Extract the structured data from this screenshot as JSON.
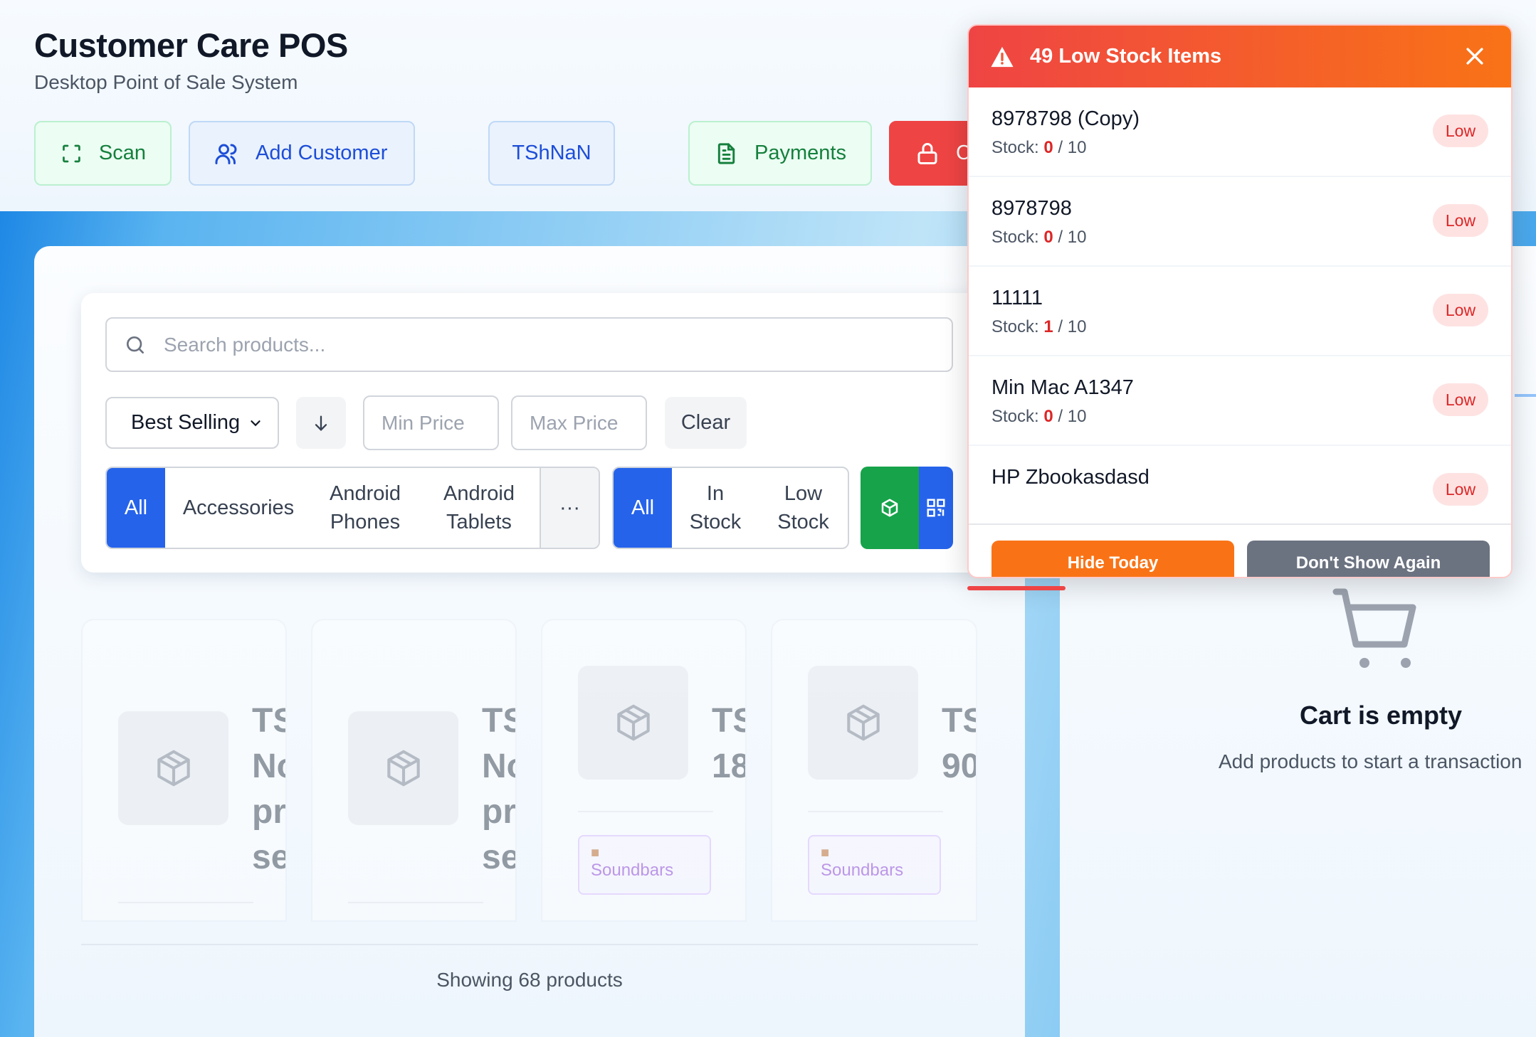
{
  "header": {
    "title": "Customer Care POS",
    "subtitle": "Desktop Point of Sale System",
    "buttons": {
      "scan": "Scan",
      "add_customer": "Add Customer",
      "currency": "TShNaN",
      "payments": "Payments",
      "close_partial": "C"
    }
  },
  "filters": {
    "search_placeholder": "Search products...",
    "sort_value": "Best Selling",
    "min_price_placeholder": "Min Price",
    "max_price_placeholder": "Max Price",
    "clear_label": "Clear",
    "categories": [
      "All",
      "Accessories",
      "Android Phones",
      "Android Tablets"
    ],
    "more_label": "···",
    "stock_filters": [
      "All",
      "In Stock",
      "Low Stock"
    ]
  },
  "products": [
    {
      "name_lines": [
        "TS",
        "No",
        "pr",
        "se"
      ],
      "category": ""
    },
    {
      "name_lines": [
        "TS",
        "No",
        "pr",
        "se"
      ],
      "category": ""
    },
    {
      "name_lines": [
        "TS",
        "18"
      ],
      "category": "Soundbars"
    },
    {
      "name_lines": [
        "TS",
        "90"
      ],
      "category": "Soundbars"
    }
  ],
  "footer": {
    "showing": "Showing 68 products"
  },
  "cart": {
    "title": "Cart is empty",
    "subtitle": "Add products to start a transaction"
  },
  "low_stock_popup": {
    "title": "49 Low Stock Items",
    "stock_label": "Stock:",
    "badge": "Low",
    "items": [
      {
        "name": "8978798 (Copy)",
        "stock": "0",
        "max": "/ 10"
      },
      {
        "name": "8978798",
        "stock": "0",
        "max": "/ 10"
      },
      {
        "name": "11111",
        "stock": "1",
        "max": "/ 10"
      },
      {
        "name": "Min Mac A1347",
        "stock": "0",
        "max": "/ 10"
      },
      {
        "name": "HP Zbookasdasd",
        "stock": "",
        "max": ""
      }
    ],
    "hide_today": "Hide Today",
    "dont_show": "Don't Show Again",
    "timer_progress": 0.18
  },
  "colors": {
    "primary": "#2563eb",
    "success": "#16a34a",
    "danger": "#ef4444",
    "warning": "#f97316",
    "muted": "#6b7280"
  }
}
